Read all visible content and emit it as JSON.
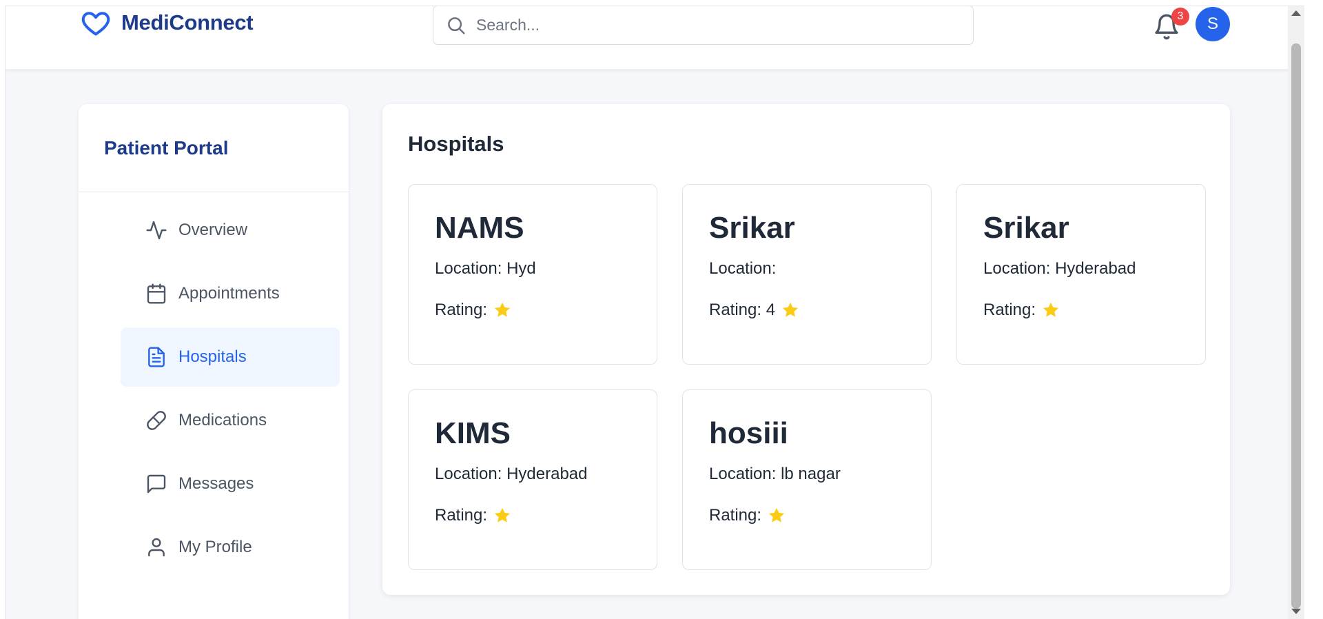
{
  "app": {
    "name": "MediConnect"
  },
  "search": {
    "placeholder": "Search..."
  },
  "notifications": {
    "count": "3"
  },
  "user": {
    "initial": "S"
  },
  "sidebar": {
    "title": "Patient Portal",
    "items": [
      {
        "label": "Overview",
        "icon": "activity-icon"
      },
      {
        "label": "Appointments",
        "icon": "calendar-icon"
      },
      {
        "label": "Hospitals",
        "icon": "document-icon",
        "active": true
      },
      {
        "label": "Medications",
        "icon": "pill-icon"
      },
      {
        "label": "Messages",
        "icon": "message-icon"
      },
      {
        "label": "My Profile",
        "icon": "user-icon"
      }
    ]
  },
  "main": {
    "title": "Hospitals",
    "hospitals": [
      {
        "name": "NAMS",
        "location": "Location: Hyd",
        "rating": "Rating: "
      },
      {
        "name": "Srikar",
        "location": "Location: ",
        "rating": "Rating: 4 "
      },
      {
        "name": "Srikar",
        "location": "Location: Hyderabad",
        "rating": "Rating: "
      },
      {
        "name": "KIMS",
        "location": "Location: Hyderabad",
        "rating": "Rating: "
      },
      {
        "name": "hosiii",
        "location": "Location: lb nagar",
        "rating": "Rating: "
      }
    ]
  },
  "colors": {
    "brand": "#1e3a8a",
    "accent": "#2563eb",
    "badge": "#ef4444",
    "star": "#facc15"
  }
}
